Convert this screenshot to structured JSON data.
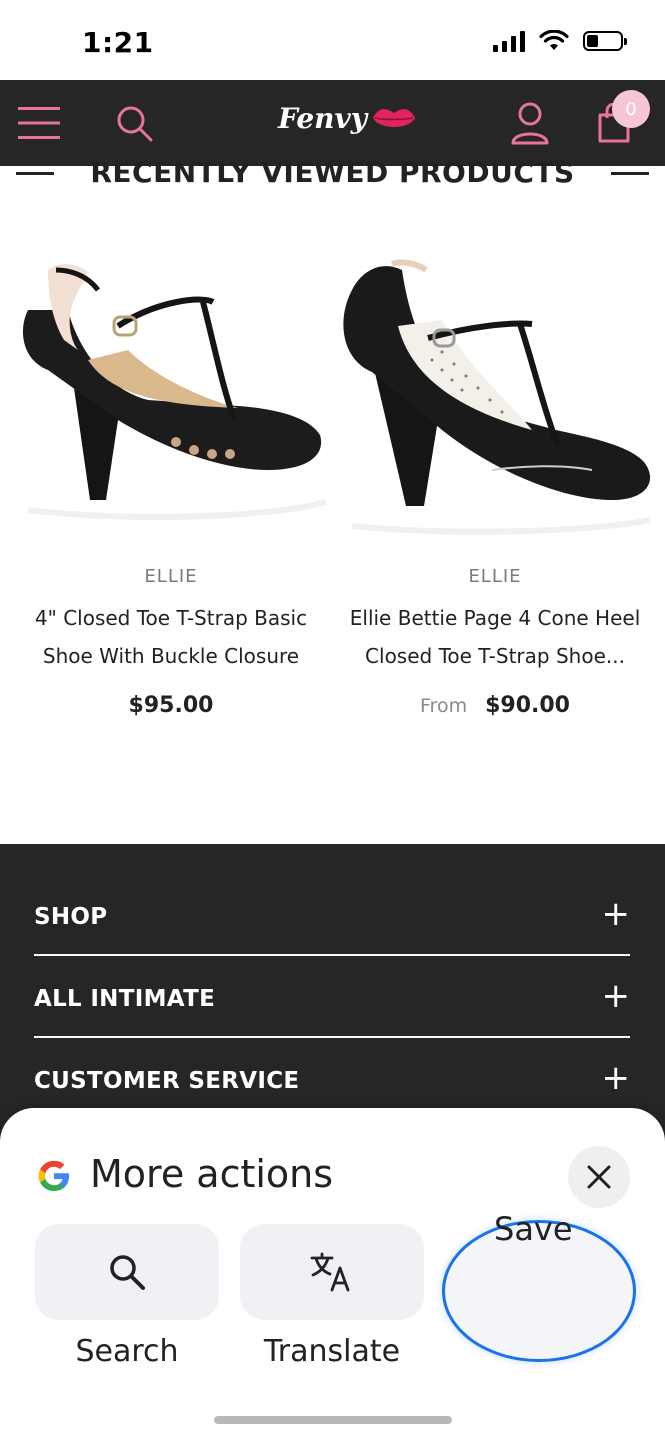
{
  "status_bar": {
    "time": "1:21",
    "battery_level": 0.35
  },
  "header": {
    "logo_text": "Fenvy",
    "cart_count": "0",
    "colors": {
      "background": "#262626",
      "accent_pink": "#e8749a",
      "logo_lips": "#e0245e"
    },
    "icons": [
      "menu-icon",
      "search-icon",
      "lips-icon",
      "account-icon",
      "cart-icon"
    ]
  },
  "section": {
    "title": "RECENTLY VIEWED PRODUCTS"
  },
  "products": [
    {
      "brand": "ELLIE",
      "name_line1": "4\" Closed Toe T-Strap Basic",
      "name_line2": "Shoe With Buckle Closure",
      "price_prefix": "",
      "price": "$95.00"
    },
    {
      "brand": "ELLIE",
      "name_line1": "Ellie Bettie Page 4 Cone Heel",
      "name_line2": "Closed Toe T-Strap Shoe...",
      "price_prefix": "From",
      "price": "$90.00"
    }
  ],
  "footer": {
    "sections": [
      {
        "label": "SHOP",
        "toggle": "+"
      },
      {
        "label": "ALL INTIMATE",
        "toggle": "+"
      },
      {
        "label": "CUSTOMER SERVICE",
        "toggle": "+"
      }
    ]
  },
  "sheet": {
    "title": "More actions",
    "close_icon": "close-icon",
    "actions": [
      {
        "label": "Search",
        "icon": "search-icon"
      },
      {
        "label": "Translate",
        "icon": "translate-icon"
      },
      {
        "label": "Save",
        "icon": "save-icon"
      }
    ],
    "highlight_color": "#1a73e8"
  }
}
